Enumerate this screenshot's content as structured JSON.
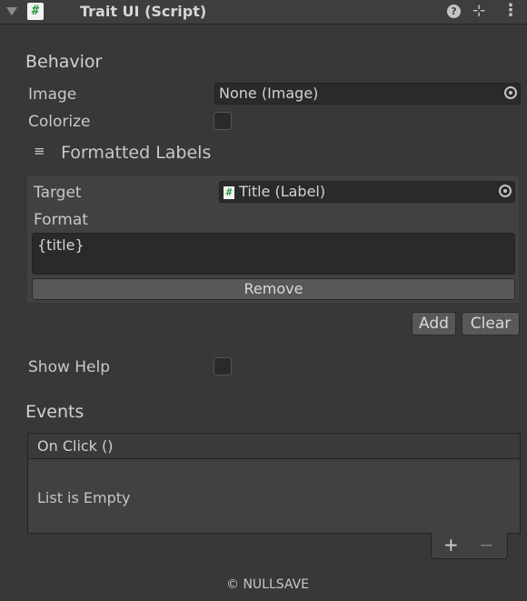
{
  "header": {
    "title": "Trait UI (Script)",
    "script_icon": "#",
    "help_icon": "?",
    "presets_icon": "⊹",
    "menu_icon": "⋮"
  },
  "behavior": {
    "section_label": "Behavior",
    "image_label": "Image",
    "image_value": "None (Image)",
    "colorize_label": "Colorize",
    "colorize_checked": false,
    "formatted_labels_icon": "≡",
    "formatted_labels_label": "Formatted Labels",
    "list_item": {
      "target_label": "Target",
      "target_value": "Title (Label)",
      "target_icon": "#",
      "format_label": "Format",
      "format_value": "{title}",
      "remove_label": "Remove"
    },
    "add_label": "Add",
    "clear_label": "Clear",
    "show_help_label": "Show Help",
    "show_help_checked": false
  },
  "events": {
    "section_label": "Events",
    "on_click_label": "On Click ()",
    "empty_label": "List is Empty",
    "add_symbol": "+",
    "remove_symbol": "−"
  },
  "footer": {
    "copyright": "© NULLSAVE"
  }
}
